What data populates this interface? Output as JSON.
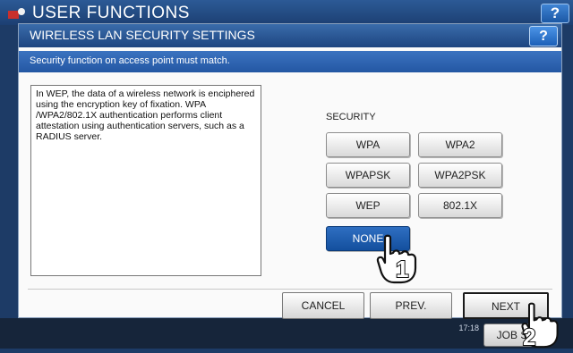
{
  "background": {
    "title": "USER FUNCTIONS",
    "help_label": "?",
    "status_time": "17:18",
    "job_button_label": "JOB S"
  },
  "dialog": {
    "title": "WIRELESS LAN SECURITY SETTINGS",
    "help_label": "?",
    "message": "Security function on access point must match.",
    "description": "In WEP, the data of a wireless network is enciphered using the encryption key of fixation. WPA /WPA2/802.1X authentication performs client attestation using authentication servers, such as a RADIUS server."
  },
  "security": {
    "label": "SECURITY",
    "options": [
      "WPA",
      "WPA2",
      "WPAPSK",
      "WPA2PSK",
      "WEP",
      "802.1X",
      "NONE"
    ],
    "selected": "NONE"
  },
  "footer": {
    "cancel_label": "CANCEL",
    "prev_label": "PREV.",
    "next_label": "NEXT"
  },
  "callouts": {
    "step1": "1",
    "step2": "2"
  },
  "colors": {
    "title_bar": "#1d4580",
    "message_bar": "#2457a3",
    "selected_button": "#134f9e"
  }
}
